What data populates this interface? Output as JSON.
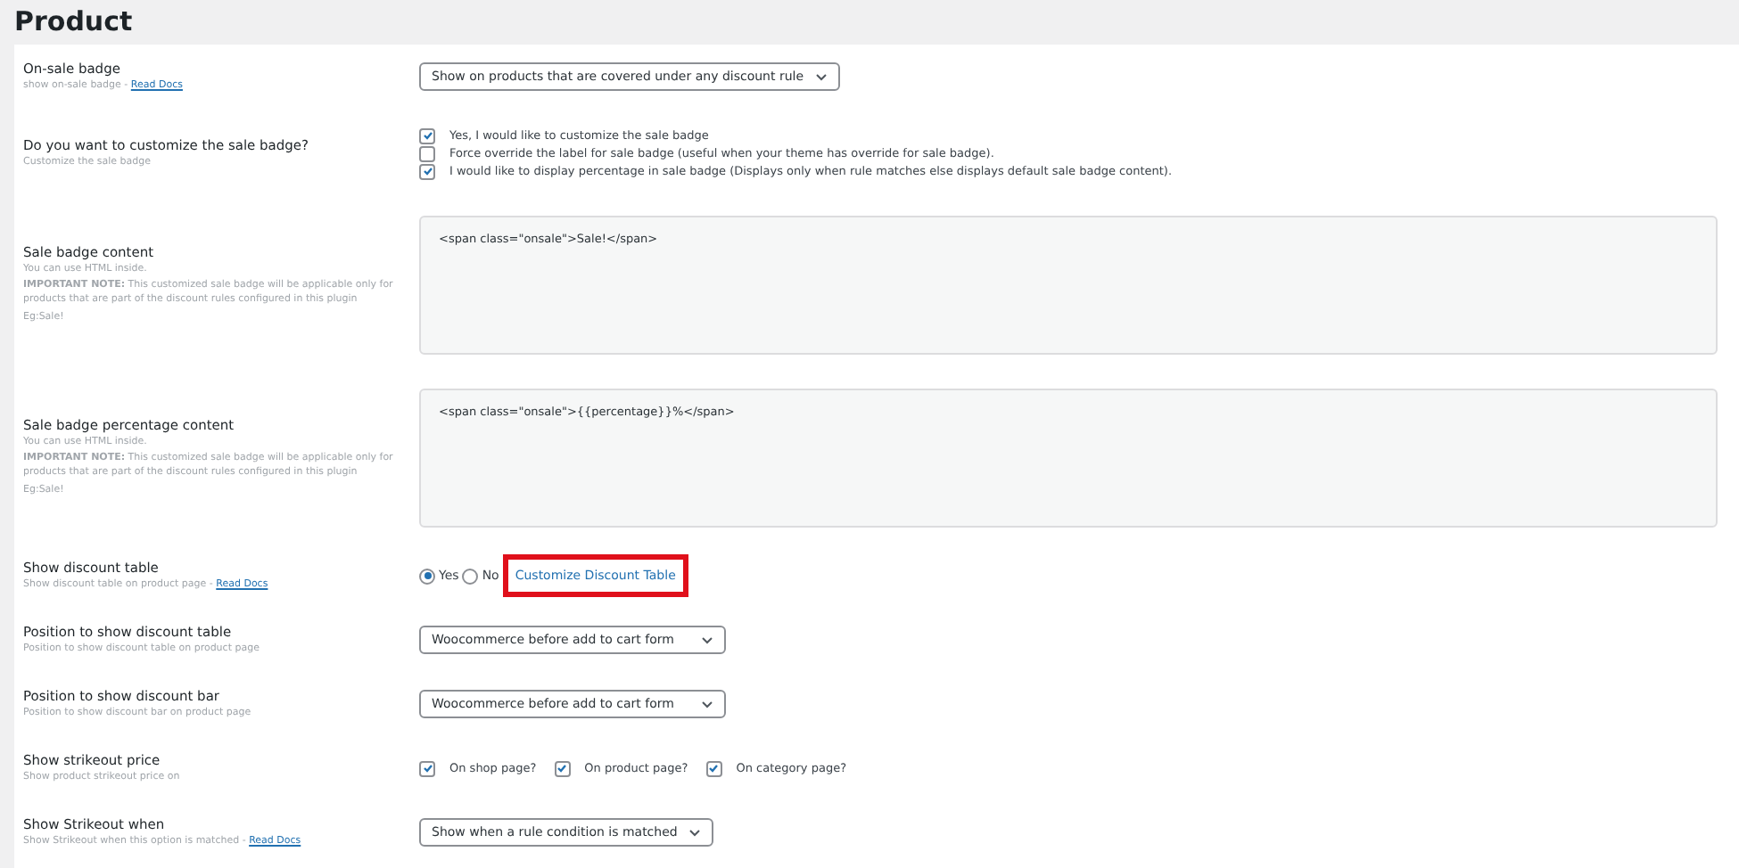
{
  "title": "Product",
  "settings": [
    {
      "kind": "select",
      "label": "On-sale badge",
      "description": [
        "show on-sale badge - "
      ],
      "link": "Read Docs",
      "value": "Show on products that are covered under any discount rule"
    },
    {
      "kind": "checklist",
      "label": "Do you want to customize the sale badge?",
      "description": [
        "Customize the sale badge"
      ],
      "options": [
        {
          "label": "Yes, I would like to customize the sale badge",
          "checked": true
        },
        {
          "label": "Force override the label for sale badge (useful when your theme has override for sale badge).",
          "checked": false
        },
        {
          "label": "I would like to display percentage in sale badge (Displays only when rule matches else displays default sale badge content).",
          "checked": true
        }
      ]
    },
    {
      "kind": "textarea",
      "label": "Sale badge content",
      "description": [
        "You can use HTML inside.",
        "**IMPORTANT NOTE:** This customized sale badge will be applicable only for products that are part of the discount rules configured in this plugin",
        "Eg:Sale!"
      ],
      "value": "<span class=\"onsale\">Sale!</span>"
    },
    {
      "kind": "textarea",
      "label": "Sale badge percentage content",
      "description": [
        "You can use HTML inside.",
        "**IMPORTANT NOTE:** This customized sale badge will be applicable only for products that are part of the discount rules configured in this plugin",
        "Eg:Sale!"
      ],
      "value": "<span class=\"onsale\">{{percentage}}%</span>"
    },
    {
      "kind": "radio",
      "label": "Show discount table",
      "description": [
        "Show discount table on product page - "
      ],
      "link": "Read Docs",
      "options": [
        {
          "label": "Yes",
          "selected": true
        },
        {
          "label": "No",
          "selected": false
        }
      ],
      "action": {
        "text": "Customize Discount Table",
        "highlighted": true
      }
    },
    {
      "kind": "select",
      "label": "Position to show discount table",
      "description": [
        "Position to show discount table on product page"
      ],
      "value": "Woocommerce before add to cart form"
    },
    {
      "kind": "select",
      "label": "Position to show discount bar",
      "description": [
        "Position to show discount bar on product page"
      ],
      "value": "Woocommerce before add to cart form"
    },
    {
      "kind": "inline",
      "label": "Show strikeout price",
      "description": [
        "Show product strikeout price on"
      ],
      "options": [
        {
          "label": "On shop page?",
          "checked": true
        },
        {
          "label": "On product page?",
          "checked": true
        },
        {
          "label": "On category page?",
          "checked": true
        }
      ]
    },
    {
      "kind": "select",
      "label": "Show Strikeout when",
      "description": [
        "Show Strikeout when this option is matched - "
      ],
      "link": "Read Docs",
      "value": "Show when a rule condition is matched"
    }
  ]
}
